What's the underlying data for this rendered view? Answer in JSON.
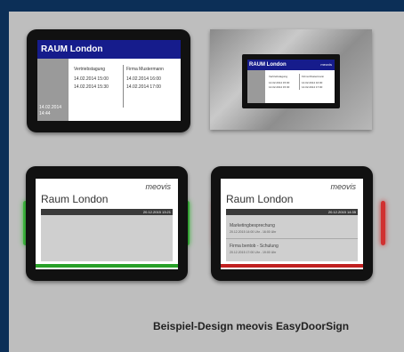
{
  "caption": "Beispiel-Design meovis EasyDoorSign",
  "colors": {
    "page_border": "#0c2f57",
    "panel": "#bebebe",
    "header_blue": "#161c8c",
    "status_green": "#28a028",
    "status_red": "#c02020"
  },
  "tablet_top_left": {
    "title": "RAUM London",
    "left_date": "14.02.2014",
    "left_time": "14:44",
    "col1": {
      "title": "Vertriebstagung",
      "line1": "14.02.2014  15:00",
      "line2": "14.02.2014  15:30"
    },
    "col2": {
      "title": "Firma Mustermann",
      "line1": "14.02.2014  16:00",
      "line2": "14.02.2014  17:00"
    }
  },
  "tablet_top_right": {
    "title": "RAUM London",
    "logo": "meovis",
    "col1": {
      "title": "Vertriebstagung",
      "line1": "14.02.2014  15:00",
      "line2": "14.02.2014  15:30"
    },
    "col2": {
      "title": "Firma Mustermann",
      "line1": "14.02.2014  16:00",
      "line2": "14.02.2014  17:00"
    }
  },
  "tablet_bottom_left": {
    "logo": "meovis",
    "room": "Raum London",
    "datetime": "20.12.2015  13:21",
    "status_color": "green"
  },
  "tablet_bottom_right": {
    "logo": "meovis",
    "room": "Raum London",
    "datetime": "20.12.2015  14:35",
    "status_color": "red",
    "events": [
      {
        "title": "Marketingbesprechung",
        "time": "20.12.2015   14:00 Uhr  -  16:00 Uhr"
      },
      {
        "title": "Firma bentob - Schulung",
        "time": "20.12.2015   17:00 Uhr  -  19:00 Uhr"
      }
    ]
  }
}
